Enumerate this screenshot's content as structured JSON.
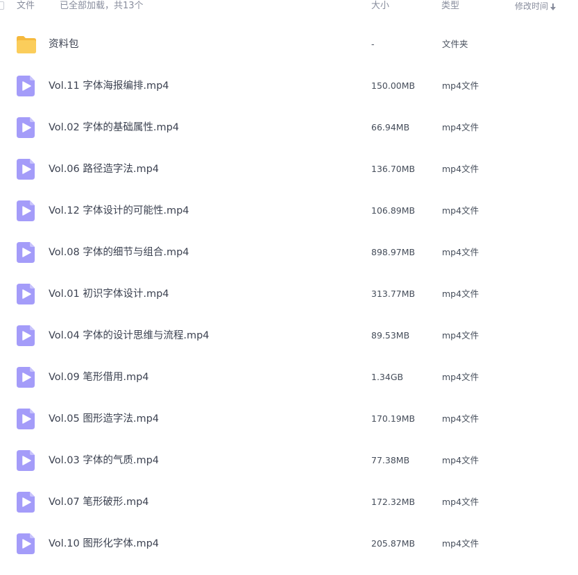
{
  "header": {
    "name_label": "文件",
    "count_label": "已全部加载，共13个",
    "size_label": "大小",
    "type_label": "类型",
    "time_label": "修改时间"
  },
  "colors": {
    "video_icon": "#a49cf9",
    "folder_icon": "#fbcd5b",
    "text": "#3b4150",
    "muted": "#878c9c"
  },
  "files": [
    {
      "name": "资料包",
      "size": "-",
      "type": "文件夹",
      "icon": "folder-icon"
    },
    {
      "name": "Vol.11 字体海报编排.mp4",
      "size": "150.00MB",
      "type": "mp4文件",
      "icon": "video-file-icon"
    },
    {
      "name": "Vol.02 字体的基础属性.mp4",
      "size": "66.94MB",
      "type": "mp4文件",
      "icon": "video-file-icon"
    },
    {
      "name": "Vol.06 路径造字法.mp4",
      "size": "136.70MB",
      "type": "mp4文件",
      "icon": "video-file-icon"
    },
    {
      "name": "Vol.12 字体设计的可能性.mp4",
      "size": "106.89MB",
      "type": "mp4文件",
      "icon": "video-file-icon"
    },
    {
      "name": "Vol.08 字体的细节与组合.mp4",
      "size": "898.97MB",
      "type": "mp4文件",
      "icon": "video-file-icon"
    },
    {
      "name": "Vol.01 初识字体设计.mp4",
      "size": "313.77MB",
      "type": "mp4文件",
      "icon": "video-file-icon"
    },
    {
      "name": "Vol.04 字体的设计思维与流程.mp4",
      "size": "89.53MB",
      "type": "mp4文件",
      "icon": "video-file-icon"
    },
    {
      "name": "Vol.09 笔形借用.mp4",
      "size": "1.34GB",
      "type": "mp4文件",
      "icon": "video-file-icon"
    },
    {
      "name": "Vol.05 图形造字法.mp4",
      "size": "170.19MB",
      "type": "mp4文件",
      "icon": "video-file-icon"
    },
    {
      "name": "Vol.03 字体的气质.mp4",
      "size": "77.38MB",
      "type": "mp4文件",
      "icon": "video-file-icon"
    },
    {
      "name": "Vol.07 笔形破形.mp4",
      "size": "172.32MB",
      "type": "mp4文件",
      "icon": "video-file-icon"
    },
    {
      "name": "Vol.10 图形化字体.mp4",
      "size": "205.87MB",
      "type": "mp4文件",
      "icon": "video-file-icon"
    }
  ]
}
